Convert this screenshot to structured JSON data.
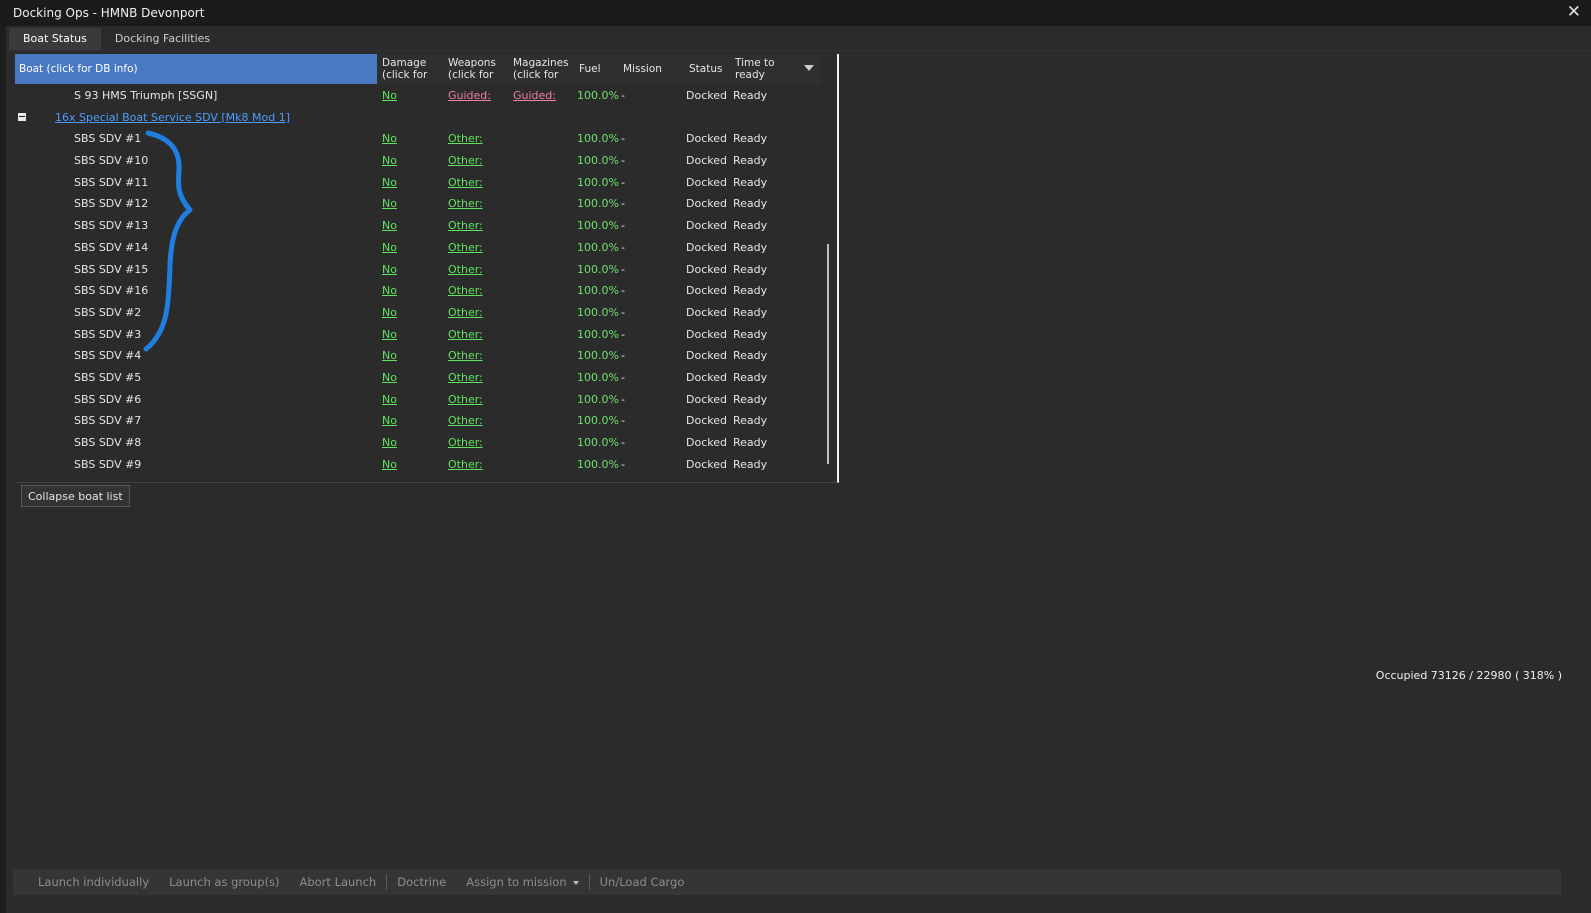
{
  "window": {
    "title": "Docking Ops - HMNB Devonport",
    "close_glyph": "✕"
  },
  "tabs": [
    {
      "label": "Boat Status",
      "active": true
    },
    {
      "label": "Docking Facilities",
      "active": false
    }
  ],
  "table": {
    "headers": {
      "boat": "Boat (click for DB info)",
      "damage_1": "Damage",
      "damage_2": "(click for",
      "weapons_1": "Weapons",
      "weapons_2": "(click for",
      "magazines_1": "Magazines",
      "magazines_2": "(click for",
      "fuel": "Fuel",
      "mission": "Mission",
      "status": "Status",
      "ttr_1": "Time to",
      "ttr_2": "ready"
    },
    "first_row": {
      "name": "S 93 HMS Triumph [SSGN]",
      "damage": "No",
      "weapons": "Guided:",
      "magazines": "Guided:",
      "fuel": "100.0%",
      "mission": "-",
      "status": "Docked",
      "ttr": "Ready"
    },
    "group": {
      "name": "16x Special Boat Service SDV [Mk8 Mod 1]",
      "expander": "collapse"
    },
    "rows": [
      {
        "name": "SBS SDV #1",
        "damage": "No",
        "weapons": "Other:",
        "fuel": "100.0%",
        "mission": "-",
        "status": "Docked",
        "ttr": "Ready"
      },
      {
        "name": "SBS SDV #10",
        "damage": "No",
        "weapons": "Other:",
        "fuel": "100.0%",
        "mission": "-",
        "status": "Docked",
        "ttr": "Ready"
      },
      {
        "name": "SBS SDV #11",
        "damage": "No",
        "weapons": "Other:",
        "fuel": "100.0%",
        "mission": "-",
        "status": "Docked",
        "ttr": "Ready"
      },
      {
        "name": "SBS SDV #12",
        "damage": "No",
        "weapons": "Other:",
        "fuel": "100.0%",
        "mission": "-",
        "status": "Docked",
        "ttr": "Ready"
      },
      {
        "name": "SBS SDV #13",
        "damage": "No",
        "weapons": "Other:",
        "fuel": "100.0%",
        "mission": "-",
        "status": "Docked",
        "ttr": "Ready"
      },
      {
        "name": "SBS SDV #14",
        "damage": "No",
        "weapons": "Other:",
        "fuel": "100.0%",
        "mission": "-",
        "status": "Docked",
        "ttr": "Ready"
      },
      {
        "name": "SBS SDV #15",
        "damage": "No",
        "weapons": "Other:",
        "fuel": "100.0%",
        "mission": "-",
        "status": "Docked",
        "ttr": "Ready"
      },
      {
        "name": "SBS SDV #16",
        "damage": "No",
        "weapons": "Other:",
        "fuel": "100.0%",
        "mission": "-",
        "status": "Docked",
        "ttr": "Ready"
      },
      {
        "name": "SBS SDV #2",
        "damage": "No",
        "weapons": "Other:",
        "fuel": "100.0%",
        "mission": "-",
        "status": "Docked",
        "ttr": "Ready"
      },
      {
        "name": "SBS SDV #3",
        "damage": "No",
        "weapons": "Other:",
        "fuel": "100.0%",
        "mission": "-",
        "status": "Docked",
        "ttr": "Ready"
      },
      {
        "name": "SBS SDV #4",
        "damage": "No",
        "weapons": "Other:",
        "fuel": "100.0%",
        "mission": "-",
        "status": "Docked",
        "ttr": "Ready"
      },
      {
        "name": "SBS SDV #5",
        "damage": "No",
        "weapons": "Other:",
        "fuel": "100.0%",
        "mission": "-",
        "status": "Docked",
        "ttr": "Ready"
      },
      {
        "name": "SBS SDV #6",
        "damage": "No",
        "weapons": "Other:",
        "fuel": "100.0%",
        "mission": "-",
        "status": "Docked",
        "ttr": "Ready"
      },
      {
        "name": "SBS SDV #7",
        "damage": "No",
        "weapons": "Other:",
        "fuel": "100.0%",
        "mission": "-",
        "status": "Docked",
        "ttr": "Ready"
      },
      {
        "name": "SBS SDV #8",
        "damage": "No",
        "weapons": "Other:",
        "fuel": "100.0%",
        "mission": "-",
        "status": "Docked",
        "ttr": "Ready"
      },
      {
        "name": "SBS SDV #9",
        "damage": "No",
        "weapons": "Other:",
        "fuel": "100.0%",
        "mission": "-",
        "status": "Docked",
        "ttr": "Ready"
      }
    ]
  },
  "collapse_button": "Collapse boat list",
  "occupied": "Occupied 73126 / 22980 ( 318% )",
  "toolbar": {
    "launch_individually": "Launch individually",
    "launch_group": "Launch as group(s)",
    "abort_launch": "Abort Launch",
    "doctrine": "Doctrine",
    "assign_mission": "Assign to mission",
    "unload_cargo": "Un/Load Cargo"
  },
  "colors": {
    "header_boat": "#4a79c4",
    "link_green": "#5fe35f",
    "link_pink": "#ee7fa6",
    "group_link": "#4d9cff",
    "annotation_brace": "#1e7fe0"
  }
}
